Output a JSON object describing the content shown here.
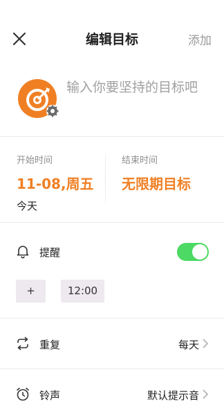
{
  "header": {
    "title": "编辑目标",
    "add_label": "添加"
  },
  "goal": {
    "placeholder": "输入你要坚持的目标吧"
  },
  "time": {
    "start_label": "开始时间",
    "start_value": "11-08,周五",
    "start_sub": "今天",
    "end_label": "结束时间",
    "end_value": "无限期目标"
  },
  "reminder": {
    "label": "提醒",
    "enabled": true,
    "add_label": "+",
    "time": "12:00"
  },
  "repeat": {
    "label": "重复",
    "value": "每天"
  },
  "ringtone": {
    "label": "铃声",
    "value": "默认提示音"
  },
  "colors": {
    "accent": "#f07f24",
    "toggle_on": "#4cd964",
    "chip_bg": "#ede9ef"
  },
  "icons": [
    "close-icon",
    "target-icon",
    "gear-icon",
    "bell-icon",
    "repeat-icon",
    "alarm-clock-icon",
    "chevron-right-icon"
  ]
}
